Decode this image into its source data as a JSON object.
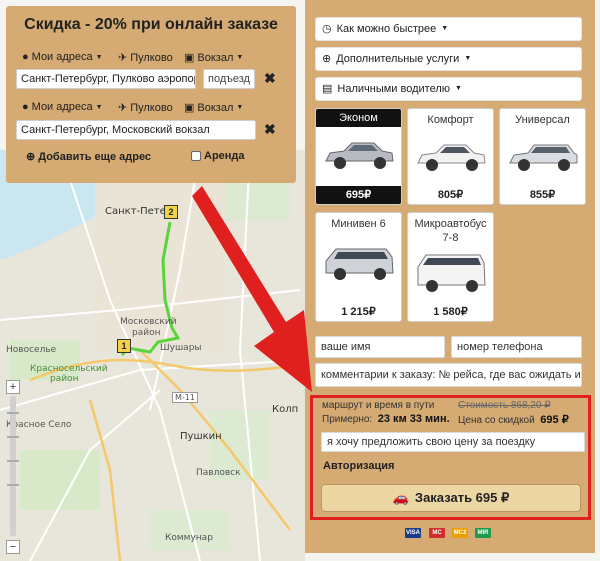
{
  "left_panel": {
    "title": "Скидка - 20% при онлайн заказе",
    "route1": {
      "addresses_label": "Мои адреса",
      "airport_label": "Пулково",
      "station_label": "Вокзал",
      "address_value": "Санкт-Петербург, Пулково аэропорт",
      "entrance_placeholder": "подъезд"
    },
    "route2": {
      "addresses_label": "Мои адреса",
      "airport_label": "Пулково",
      "station_label": "Вокзал",
      "address_value": "Санкт-Петербург, Московский вокзал"
    },
    "add_address_label": "Добавить еще адрес",
    "rent_label": "Аренда"
  },
  "right_panel": {
    "dropdowns": {
      "when": "Как можно быстрее",
      "services": "Дополнительные услуги",
      "payment": "Наличными водителю"
    },
    "cars": [
      {
        "name": "Эконом",
        "price": "695₽",
        "selected": true
      },
      {
        "name": "Комфорт",
        "price": "805₽",
        "selected": false
      },
      {
        "name": "Универсал",
        "price": "855₽",
        "selected": false
      },
      {
        "name": "Минивен 6",
        "price": "1 215₽",
        "selected": false
      },
      {
        "name": "Микроавтобус 7-8",
        "price": "1 580₽",
        "selected": false
      }
    ],
    "name_placeholder": "ваше имя",
    "phone_placeholder": "номер телефона",
    "comment_placeholder": "комментарии к заказу: № рейса, где вас ожидать и",
    "order_summary": {
      "route_time_label": "маршрут и время в пути",
      "cost_label": "Стоимость 868,20 ₽",
      "approx_label": "Примерно:",
      "approx_value": "23 км 33 мин.",
      "discount_label": "Цена со скидкой",
      "discount_value": "695 ₽",
      "own_price_placeholder": "я хочу предложить свою цену за поездку",
      "auth_label": "Авторизация",
      "order_button": "Заказать 695 ₽"
    },
    "payment_icons": [
      "VISA",
      "MC",
      "MC2",
      "MIR"
    ]
  },
  "map": {
    "labels": {
      "spb": "Санкт-Петер",
      "moskovsky": "Московский",
      "rayon": "район",
      "shushary": "Шушары",
      "novoselye": "Новоселье",
      "krasnoselsky": "Красносельский",
      "rayon2": "район",
      "krasnoe_selo": "Красное Село",
      "kolpino": "Колп",
      "pushkin": "Пушкин",
      "pavlovsk": "Павловск",
      "kommunar": "Коммунар",
      "m11": "М-11"
    },
    "markers": {
      "a": "1",
      "b": "2"
    },
    "zoom_in": "+",
    "zoom_out": "−"
  },
  "colors": {
    "panel": "#d5ab73",
    "accent": "#e0201e",
    "route": "#59d43a",
    "selected": "#111111"
  }
}
